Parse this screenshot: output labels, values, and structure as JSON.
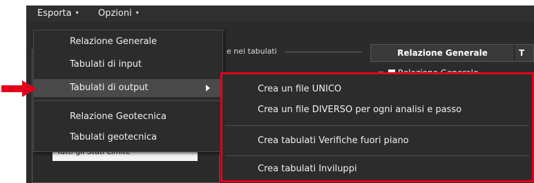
{
  "menubar": {
    "export_label": "Esporta",
    "options_label": "Opzioni",
    "caret_glyph": "▾"
  },
  "background": {
    "group_legend": "e nei tabulati",
    "hidden_field_text": "Tutti gli Stati Limite",
    "tab_active": "Relazione Generale",
    "tab_next": "T",
    "tree_row_text": "Relazione Generale"
  },
  "export_menu": {
    "items": [
      {
        "label": "Relazione Generale"
      },
      {
        "label": "Tabulati di input"
      },
      {
        "label": "Tabulati di output"
      },
      {
        "label": "Relazione Geotecnica"
      },
      {
        "label": "Tabulati geotecnica"
      }
    ],
    "highlighted_index": 2
  },
  "output_submenu": {
    "items": [
      {
        "label": "Crea un file UNICO"
      },
      {
        "label": "Crea un file DIVERSO per ogni analisi e passo"
      },
      {
        "label": "Crea tabulati Verifiche fuori piano"
      },
      {
        "label": "Crea tabulati Inviluppi"
      }
    ]
  },
  "annotation": {
    "highlight_color": "#e3001b",
    "pointer_icon": "red-arrow-icon"
  }
}
